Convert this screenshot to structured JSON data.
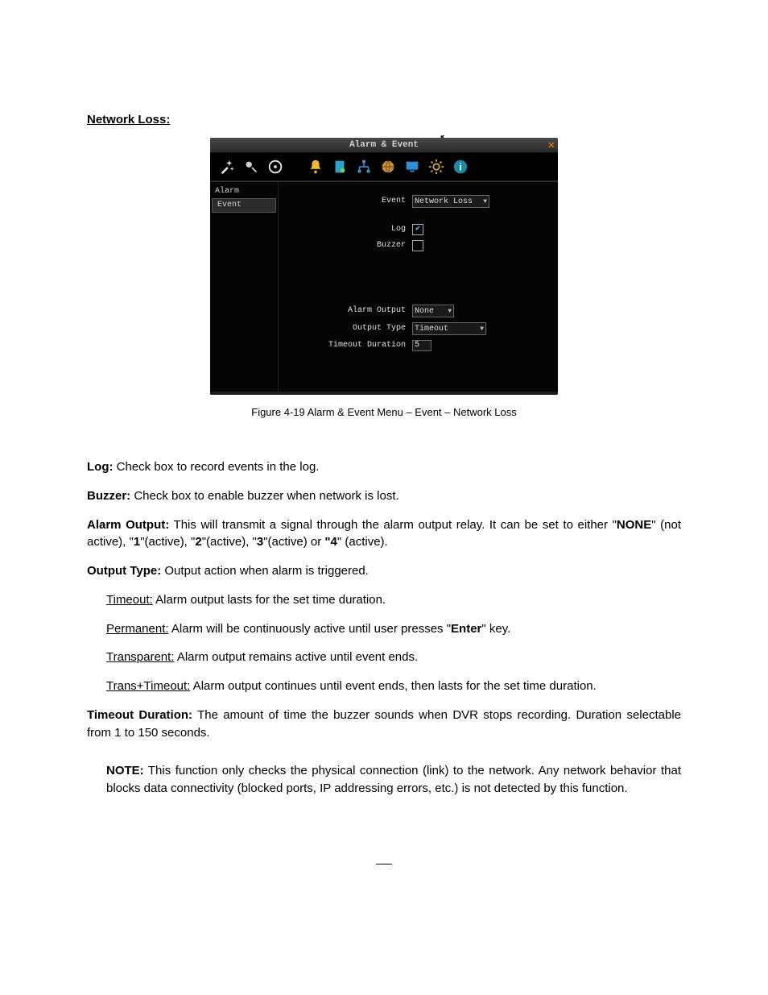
{
  "heading": "Network Loss:",
  "screenshot": {
    "title": "Alarm & Event",
    "close": "✕",
    "toolbar": {
      "wand": "wand-icon",
      "detect": "motion-icon",
      "disc": "disc-icon",
      "bell": "bell-icon",
      "page": "page-icon",
      "net": "network-icon",
      "globe": "globe-icon",
      "monitor": "monitor-icon",
      "gear": "gear-icon",
      "info": "info-icon"
    },
    "sidebar": {
      "items": [
        "Alarm",
        "Event"
      ],
      "active_index": 1
    },
    "form": {
      "event_label": "Event",
      "event_value": "Network Loss",
      "log_label": "Log",
      "log_checked": true,
      "buzzer_label": "Buzzer",
      "buzzer_checked": false,
      "alarm_output_label": "Alarm Output",
      "alarm_output_value": "None",
      "output_type_label": "Output Type",
      "output_type_value": "Timeout",
      "timeout_label": "Timeout Duration",
      "timeout_value": "5"
    }
  },
  "caption": "Figure 4-19 Alarm & Event Menu – Event – Network Loss",
  "paragraphs": {
    "log_b": "Log:",
    "log_t": " Check box to record events in the log.",
    "buz_b": "Buzzer:",
    "buz_t": " Check box to enable buzzer when network is lost.",
    "ao_b": "Alarm Output:",
    "ao_t1": " This will transmit a signal through the alarm output relay. It can be set to either \"",
    "ao_none": "NONE",
    "ao_t2": "\" (not active), \"",
    "ao_1": "1",
    "ao_t3": "\"(active), \"",
    "ao_2": "2",
    "ao_t4": "\"(active), \"",
    "ao_3": "3",
    "ao_t5": "\"(active) or ",
    "ao_4q": "\"4",
    "ao_t6": "\" (active).",
    "ot_b": "Output Type:",
    "ot_t": " Output action when alarm is triggered.",
    "to_u": "Timeout:",
    "to_t": " Alarm output lasts for the set time duration.",
    "pe_u": "Permanent:",
    "pe_t1": " Alarm will be continuously active until user presses \"",
    "pe_enter": "Enter",
    "pe_t2": "\" key.",
    "tr_u": "Transparent:",
    "tr_t": " Alarm output remains active until event ends.",
    "tt_u": "Trans+Timeout:",
    "tt_t": " Alarm output continues until event ends, then lasts for the set time duration.",
    "td_b": "Timeout Duration:",
    "td_t": " The amount of time the buzzer sounds when DVR stops recording. Duration selectable from 1 to 150 seconds.",
    "note_b": "NOTE:",
    "note_t": " This function only checks the physical connection (link) to the network. Any network behavior that blocks data connectivity (blocked ports, IP addressing errors, etc.) is not detected by this function."
  }
}
